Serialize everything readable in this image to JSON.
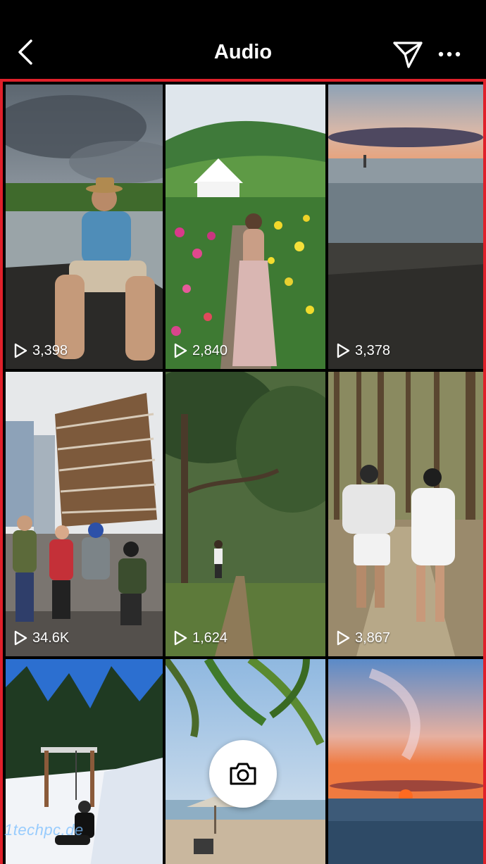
{
  "header": {
    "title": "Audio",
    "back_icon": "chevron-left-icon",
    "share_icon": "paper-plane-icon",
    "more_icon": "more-dots-icon"
  },
  "grid": {
    "border_color": "#e0202a",
    "tiles": [
      {
        "subject": "man-in-boat",
        "views": "3,398"
      },
      {
        "subject": "woman-in-flower-field",
        "views": "2,840"
      },
      {
        "subject": "sunset-beach",
        "views": "3,378"
      },
      {
        "subject": "group-at-vessel-building",
        "views": "34.6K"
      },
      {
        "subject": "woman-on-forest-path",
        "views": "1,624"
      },
      {
        "subject": "couple-in-pine-forest",
        "views": "3,867"
      },
      {
        "subject": "person-on-snow-swing",
        "views": ""
      },
      {
        "subject": "palm-beach",
        "views": ""
      },
      {
        "subject": "ocean-sunset",
        "views": ""
      }
    ]
  },
  "camera_button": {
    "icon": "camera-icon"
  },
  "watermark": "1techpc.de"
}
